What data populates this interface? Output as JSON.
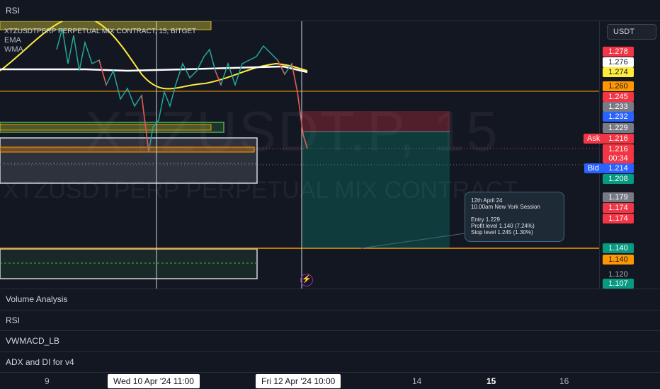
{
  "top_pane": {
    "label": "RSI"
  },
  "symbol": {
    "full": "XTZUSDTPERP PERPETUAL MIX CONTRACT, 15, BITGET",
    "watermark_main": "XTZUSDT.P, 15",
    "watermark_sub": "XTZUSDTPERP PERPETUAL MIX CONTRACT"
  },
  "indicators": {
    "ema": "EMA",
    "wma": "WMA"
  },
  "currency": "USDT",
  "price_labels": [
    {
      "text": "1.278",
      "bg": "#f23645",
      "fg": "#ffffff"
    },
    {
      "text": "1.276",
      "bg": "#ffffff",
      "fg": "#131722"
    },
    {
      "text": "1.274",
      "bg": "#ffeb3b",
      "fg": "#131722"
    },
    {
      "text": "1.260",
      "bg": "#ff9800",
      "fg": "#131722"
    },
    {
      "text": "1.245",
      "bg": "#f23645",
      "fg": "#ffffff"
    },
    {
      "text": "1.233",
      "bg": "#787b86",
      "fg": "#ffffff"
    },
    {
      "text": "1.232",
      "bg": "#2962ff",
      "fg": "#ffffff"
    },
    {
      "text": "1.229",
      "bg": "#787b86",
      "fg": "#ffffff"
    },
    {
      "text": "1.216",
      "bg": "#f23645",
      "fg": "#ffffff"
    },
    {
      "text": "1.216",
      "bg": "#f23645",
      "fg": "#ffffff"
    },
    {
      "text": "00:34",
      "bg": "#f23645",
      "fg": "#ffffff"
    },
    {
      "text": "1.214",
      "bg": "#2962ff",
      "fg": "#ffffff"
    },
    {
      "text": "1.208",
      "bg": "#089981",
      "fg": "#ffffff"
    },
    {
      "text": "1.179",
      "bg": "#787b86",
      "fg": "#ffffff"
    },
    {
      "text": "1.174",
      "bg": "#f23645",
      "fg": "#ffffff"
    },
    {
      "text": "1.174",
      "bg": "#f23645",
      "fg": "#ffffff"
    },
    {
      "text": "1.140",
      "bg": "#089981",
      "fg": "#ffffff"
    },
    {
      "text": "1.140",
      "bg": "#ff9800",
      "fg": "#131722"
    },
    {
      "text": "1.120",
      "bg": "transparent",
      "fg": "#b2b5be"
    },
    {
      "text": "1.107",
      "bg": "#089981",
      "fg": "#ffffff"
    }
  ],
  "ask_label": "Ask",
  "bid_label": "Bid",
  "note": {
    "line1": "12th April 24",
    "line2": "10.00am  New York Session",
    "line3": "Entry 1.229",
    "line4": "Profit level 1.140 (7.24%)",
    "line5": "Stop level  1.245 (1.30%)"
  },
  "panes": [
    "Volume Analysis",
    "RSI",
    "VWMACD_LB",
    "ADX and DI for v4"
  ],
  "time_axis": {
    "ticks": [
      {
        "text": "9",
        "bold": false
      },
      {
        "text": "14",
        "bold": false
      },
      {
        "text": "15",
        "bold": true
      },
      {
        "text": "16",
        "bold": false
      }
    ],
    "cursor1": "Wed 10 Apr '24   11:00",
    "cursor2": "Fri 12 Apr '24   10:00"
  },
  "colors": {
    "background": "#131722",
    "up": "#26a69a",
    "down": "#ef5350",
    "ema": "#ffffff",
    "wma": "#ffeb3b",
    "level_orange": "#ff9800",
    "profit_zone": "#0b4f47",
    "stop_zone": "#5c1e24"
  }
}
